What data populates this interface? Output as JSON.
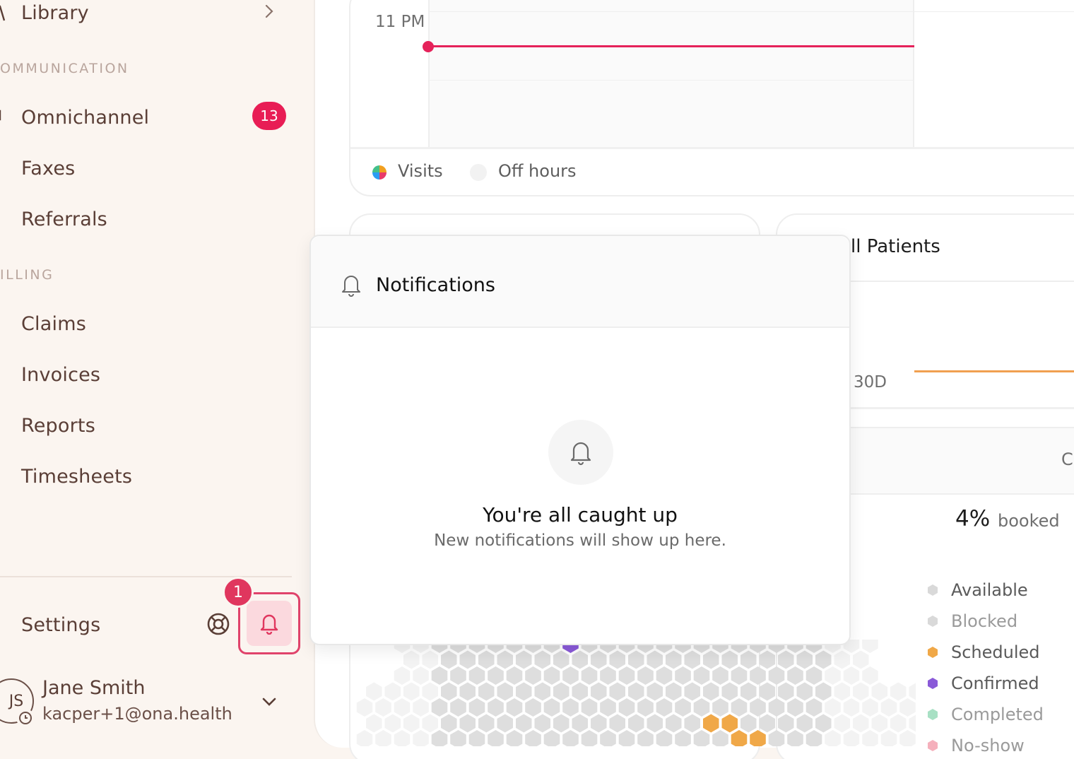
{
  "sidebar": {
    "library": "Library",
    "sections": {
      "communication": "OMMUNICATION",
      "billing": "ILLING"
    },
    "items": {
      "omnichannel": {
        "label": "Omnichannel",
        "badge": "13"
      },
      "faxes": {
        "label": "Faxes"
      },
      "referrals": {
        "label": "Referrals"
      },
      "claims": {
        "label": "Claims"
      },
      "invoices": {
        "label": "Invoices"
      },
      "reports": {
        "label": "Reports"
      },
      "timesheets": {
        "label": "Timesheets"
      },
      "settings": {
        "label": "Settings"
      }
    },
    "notifications_badge": "1",
    "user": {
      "initials": "JS",
      "name": "Jane Smith",
      "email": "kacper+1@ona.health"
    }
  },
  "calendar": {
    "time_label": "11 PM",
    "legend": {
      "visits": "Visits",
      "off_hours": "Off hours"
    },
    "now_color": "#e5225a"
  },
  "patients": {
    "title": "ll Patients",
    "range": "30D",
    "column_partial": "C",
    "booked_pct": "4%",
    "booked_label": "booked",
    "statuses": [
      {
        "label": "Available",
        "color": "#d9d9d9",
        "text_color": "#5a5a5a"
      },
      {
        "label": "Blocked",
        "color": "#d9d9d9",
        "text_color": "#9a9a9a"
      },
      {
        "label": "Scheduled",
        "color": "#f0a848",
        "text_color": "#5a5a5a"
      },
      {
        "label": "Confirmed",
        "color": "#8a5ad8",
        "text_color": "#5a5a5a"
      },
      {
        "label": "Completed",
        "color": "#a8e0c4",
        "text_color": "#9a9a9a"
      },
      {
        "label": "No-show",
        "color": "#f5b0bc",
        "text_color": "#9a9a9a"
      }
    ]
  },
  "notifications": {
    "title": "Notifications",
    "empty_title": "You're all caught up",
    "empty_subtitle": "New notifications will show up here."
  },
  "colors": {
    "accent": "#e81d55",
    "sidebar_bg": "#fbf5f0",
    "hex_empty": "#dedede"
  }
}
